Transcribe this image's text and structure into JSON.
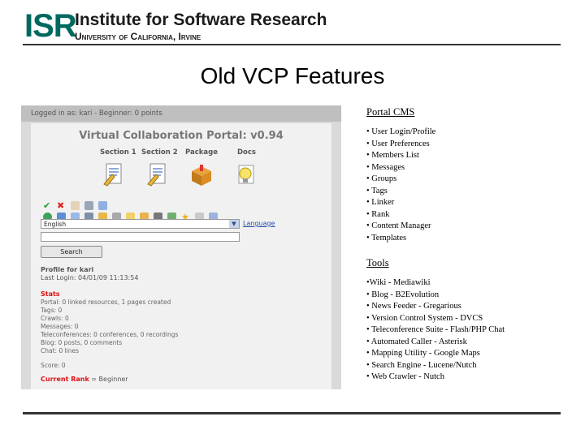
{
  "header": {
    "logo_mark": "ISR",
    "institute": "Institute for Software Research",
    "university": "University of California, Irvine"
  },
  "slide": {
    "title": "Old VCP Features"
  },
  "screenshot": {
    "login_bar": "Logged in as: kari - Beginner: 0 points",
    "portal_title": "Virtual Collaboration Portal: v0.94",
    "nav": [
      "Section 1",
      "Section 2",
      "Package",
      "Docs"
    ],
    "language_value": "English",
    "language_link": "Language",
    "search_button": "Search",
    "profile_title": "Profile for kari",
    "last_login": "Last Login: 04/01/09 11:13:54",
    "stats_title": "Stats",
    "stats": [
      "Portal: 0 linked resources, 1 pages created",
      "Tags: 0",
      "Crawls: 0",
      "Messages: 0",
      "Teleconferences: 0 conferences, 0 recordings",
      "Blog: 0 posts, 0 comments",
      "Chat: 0 lines"
    ],
    "score": "Score: 0",
    "rank_label": "Current Rank",
    "rank_value": " = Beginner",
    "icon_names": [
      "document-icon",
      "document-icon",
      "package-icon",
      "lightbulb-icon"
    ],
    "toolbar_row1": [
      "check-icon",
      "x-icon",
      "hand-icon",
      "wrench-icon",
      "mail-icon"
    ],
    "toolbar_row2": [
      "globe-icon",
      "people-icon",
      "tag-icon",
      "disk-icon",
      "pen-icon",
      "link-icon",
      "note-icon",
      "folder-icon",
      "print-icon",
      "image-icon",
      "star-icon",
      "pin-icon",
      "page-icon"
    ]
  },
  "portal_cms": {
    "heading": "Portal CMS",
    "items": [
      "• User Login/Profile",
      "• User Preferences",
      "• Members List",
      "• Messages",
      "• Groups",
      "• Tags",
      "• Linker",
      "• Rank",
      "• Content Manager",
      "• Templates"
    ]
  },
  "tools": {
    "heading": "Tools",
    "items": [
      "•Wiki - Mediawiki",
      "• Blog - B2Evolution",
      "• News Feeder - Gregarious",
      "• Version Control System - DVCS",
      "• Teleconference Suite - Flash/PHP Chat",
      "• Automated Caller - Asterisk",
      "• Mapping Utility - Google Maps",
      "• Search Engine - Lucene/Nutch",
      "• Web Crawler - Nutch"
    ]
  },
  "colors": {
    "logo_teal": "#00695f",
    "stats_red": "#dd1111",
    "link_blue": "#2a4db0"
  }
}
